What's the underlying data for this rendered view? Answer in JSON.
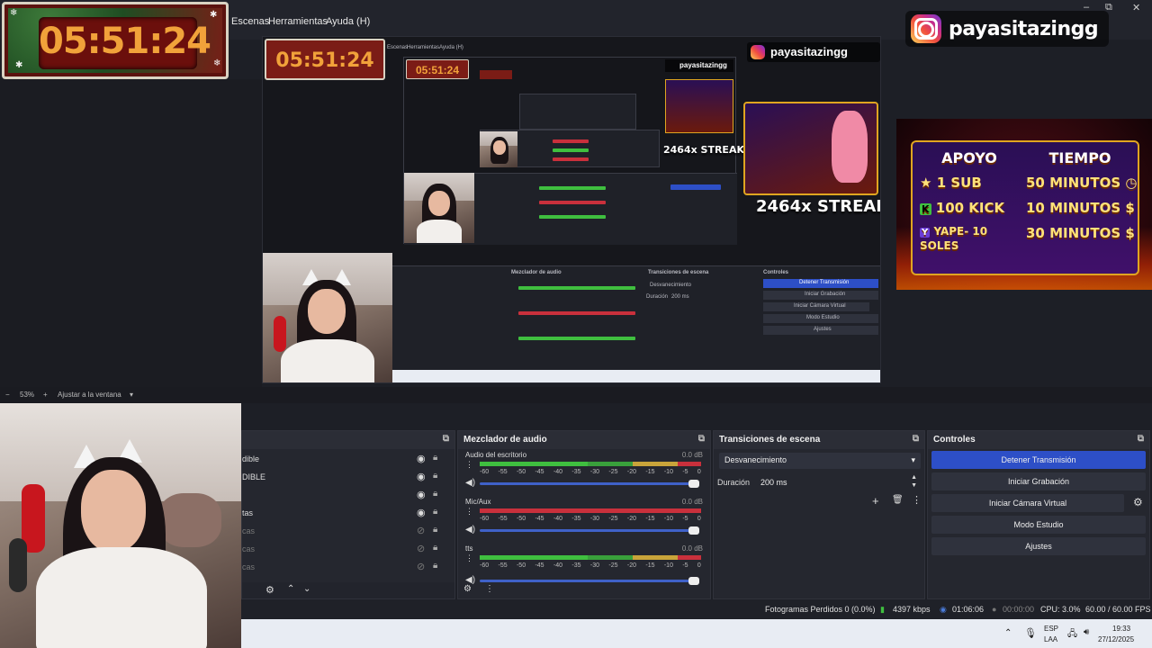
{
  "timer": {
    "value": "05:51:24"
  },
  "menu": {
    "items": [
      "Escenas",
      "Herramientas",
      "Ayuda (H)"
    ],
    "window_controls": [
      "–",
      "⧉",
      "✕"
    ]
  },
  "instagram": {
    "handle": "payasitazingg"
  },
  "preview": {
    "nested_timer": "05:51:24",
    "nested_handle": "payasitazingg",
    "streak_text": "2464x STREAK",
    "nested_menu": [
      "Escenas",
      "Herramientas",
      "Ayuda (H)"
    ],
    "nested_mixer_title": "Mezclador de audio",
    "nested_transitions_title": "Transiciones de escena",
    "nested_controls_title": "Controles",
    "nested_controls": [
      "Detener Transmisión",
      "Iniciar Grabación",
      "Iniciar Cámara Virtual",
      "Modo Estudio",
      "Ajustes"
    ],
    "nested_transition": "Desvanecimiento",
    "nested_duration_label": "Duración",
    "nested_duration": "200 ms"
  },
  "support": {
    "headers": [
      "APOYO",
      "TIEMPO"
    ],
    "rows": [
      {
        "left": "1 SUB",
        "right": "50 MINUTOS"
      },
      {
        "left": "100 KICK",
        "right": "10 MINUTOS"
      },
      {
        "left": "YAPE- 10 SOLES",
        "right": "30 MINUTOS"
      }
    ]
  },
  "zoom": {
    "percent": "53%",
    "fit_label": "Ajustar a la ventana",
    "minus": "−",
    "plus": "+"
  },
  "sources": {
    "items": [
      {
        "name": "dible"
      },
      {
        "name": "DIBLE"
      },
      {
        "name": ""
      },
      {
        "name": "tas"
      },
      {
        "name": "cas"
      },
      {
        "name": "cas"
      },
      {
        "name": "cas"
      }
    ]
  },
  "mixer": {
    "title": "Mezclador de audio",
    "scale": [
      "-60",
      "-55",
      "-50",
      "-45",
      "-40",
      "-35",
      "-30",
      "-25",
      "-20",
      "-15",
      "-10",
      "-5",
      "0"
    ],
    "channels": [
      {
        "name": "Audio del escritorio",
        "db": "0.0 dB"
      },
      {
        "name": "Mic/Aux",
        "db": "0.0 dB"
      },
      {
        "name": "tts",
        "db": "0.0 dB"
      }
    ]
  },
  "transitions": {
    "title": "Transiciones de escena",
    "selected": "Desvanecimiento",
    "duration_label": "Duración",
    "duration_value": "200 ms"
  },
  "controls": {
    "title": "Controles",
    "stop_stream": "Detener Transmisión",
    "start_record": "Iniciar Grabación",
    "virtual_cam": "Iniciar Cámara Virtual",
    "studio_mode": "Modo Estudio",
    "settings": "Ajustes"
  },
  "status": {
    "dropped": "Fotogramas Perdidos 0 (0.0%)",
    "bitrate": "4397 kbps",
    "stream_time": "01:06:06",
    "record_time": "00:00:00",
    "cpu": "CPU: 3.0%",
    "fps": "60.00 / 60.00 FPS"
  },
  "taskbar": {
    "lang_top": "ESP",
    "lang_bottom": "LAA",
    "time": "19:33",
    "date": "27/12/2025"
  },
  "colors": {
    "accent": "#2d4fc7",
    "meter_green": "#3fbf3f",
    "meter_red": "#c9303c",
    "meter_yellow": "#c9a43a"
  }
}
